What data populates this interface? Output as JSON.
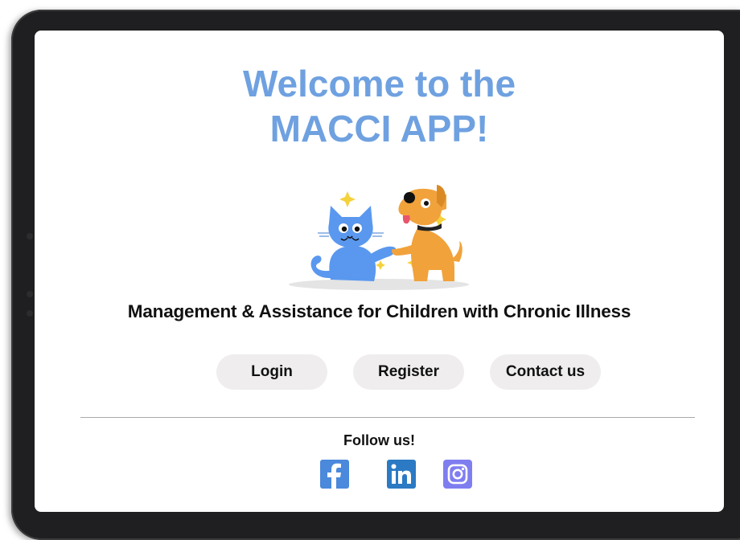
{
  "hero": {
    "title_line1": "Welcome to the",
    "title_line2": "MACCI APP!",
    "subtitle": "Management & Assistance for Children  with Chronic Illness"
  },
  "buttons": {
    "login": "Login",
    "register": "Register",
    "contact": "Contact us"
  },
  "footer": {
    "follow_label": "Follow us!",
    "social": [
      {
        "name": "facebook",
        "icon": "facebook-icon",
        "glyph": "f"
      },
      {
        "name": "linkedin",
        "icon": "linkedin-icon",
        "glyph": "in"
      },
      {
        "name": "instagram",
        "icon": "instagram-icon"
      }
    ]
  },
  "colors": {
    "title": "#6fa1e0",
    "button_bg": "#efeded",
    "facebook": "#4a89dc",
    "linkedin": "#2c7ac4",
    "instagram": "#7f7ef0"
  }
}
